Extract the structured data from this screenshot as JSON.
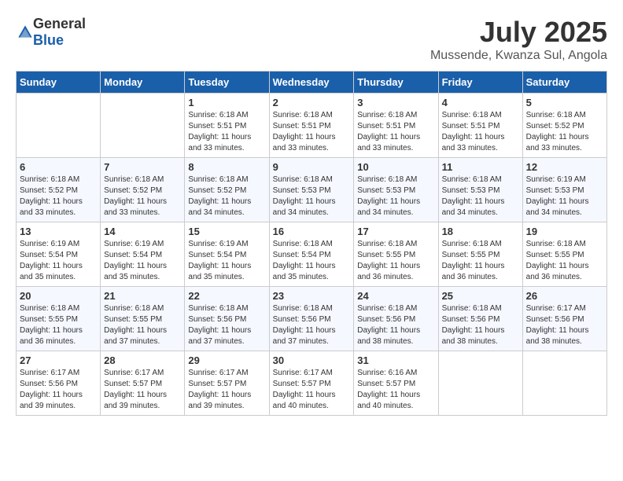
{
  "logo": {
    "text_general": "General",
    "text_blue": "Blue"
  },
  "header": {
    "month": "July 2025",
    "location": "Mussende, Kwanza Sul, Angola"
  },
  "weekdays": [
    "Sunday",
    "Monday",
    "Tuesday",
    "Wednesday",
    "Thursday",
    "Friday",
    "Saturday"
  ],
  "weeks": [
    [
      {
        "day": "",
        "sunrise": "",
        "sunset": "",
        "daylight": ""
      },
      {
        "day": "",
        "sunrise": "",
        "sunset": "",
        "daylight": ""
      },
      {
        "day": "1",
        "sunrise": "Sunrise: 6:18 AM",
        "sunset": "Sunset: 5:51 PM",
        "daylight": "Daylight: 11 hours and 33 minutes."
      },
      {
        "day": "2",
        "sunrise": "Sunrise: 6:18 AM",
        "sunset": "Sunset: 5:51 PM",
        "daylight": "Daylight: 11 hours and 33 minutes."
      },
      {
        "day": "3",
        "sunrise": "Sunrise: 6:18 AM",
        "sunset": "Sunset: 5:51 PM",
        "daylight": "Daylight: 11 hours and 33 minutes."
      },
      {
        "day": "4",
        "sunrise": "Sunrise: 6:18 AM",
        "sunset": "Sunset: 5:51 PM",
        "daylight": "Daylight: 11 hours and 33 minutes."
      },
      {
        "day": "5",
        "sunrise": "Sunrise: 6:18 AM",
        "sunset": "Sunset: 5:52 PM",
        "daylight": "Daylight: 11 hours and 33 minutes."
      }
    ],
    [
      {
        "day": "6",
        "sunrise": "Sunrise: 6:18 AM",
        "sunset": "Sunset: 5:52 PM",
        "daylight": "Daylight: 11 hours and 33 minutes."
      },
      {
        "day": "7",
        "sunrise": "Sunrise: 6:18 AM",
        "sunset": "Sunset: 5:52 PM",
        "daylight": "Daylight: 11 hours and 33 minutes."
      },
      {
        "day": "8",
        "sunrise": "Sunrise: 6:18 AM",
        "sunset": "Sunset: 5:52 PM",
        "daylight": "Daylight: 11 hours and 34 minutes."
      },
      {
        "day": "9",
        "sunrise": "Sunrise: 6:18 AM",
        "sunset": "Sunset: 5:53 PM",
        "daylight": "Daylight: 11 hours and 34 minutes."
      },
      {
        "day": "10",
        "sunrise": "Sunrise: 6:18 AM",
        "sunset": "Sunset: 5:53 PM",
        "daylight": "Daylight: 11 hours and 34 minutes."
      },
      {
        "day": "11",
        "sunrise": "Sunrise: 6:18 AM",
        "sunset": "Sunset: 5:53 PM",
        "daylight": "Daylight: 11 hours and 34 minutes."
      },
      {
        "day": "12",
        "sunrise": "Sunrise: 6:19 AM",
        "sunset": "Sunset: 5:53 PM",
        "daylight": "Daylight: 11 hours and 34 minutes."
      }
    ],
    [
      {
        "day": "13",
        "sunrise": "Sunrise: 6:19 AM",
        "sunset": "Sunset: 5:54 PM",
        "daylight": "Daylight: 11 hours and 35 minutes."
      },
      {
        "day": "14",
        "sunrise": "Sunrise: 6:19 AM",
        "sunset": "Sunset: 5:54 PM",
        "daylight": "Daylight: 11 hours and 35 minutes."
      },
      {
        "day": "15",
        "sunrise": "Sunrise: 6:19 AM",
        "sunset": "Sunset: 5:54 PM",
        "daylight": "Daylight: 11 hours and 35 minutes."
      },
      {
        "day": "16",
        "sunrise": "Sunrise: 6:18 AM",
        "sunset": "Sunset: 5:54 PM",
        "daylight": "Daylight: 11 hours and 35 minutes."
      },
      {
        "day": "17",
        "sunrise": "Sunrise: 6:18 AM",
        "sunset": "Sunset: 5:55 PM",
        "daylight": "Daylight: 11 hours and 36 minutes."
      },
      {
        "day": "18",
        "sunrise": "Sunrise: 6:18 AM",
        "sunset": "Sunset: 5:55 PM",
        "daylight": "Daylight: 11 hours and 36 minutes."
      },
      {
        "day": "19",
        "sunrise": "Sunrise: 6:18 AM",
        "sunset": "Sunset: 5:55 PM",
        "daylight": "Daylight: 11 hours and 36 minutes."
      }
    ],
    [
      {
        "day": "20",
        "sunrise": "Sunrise: 6:18 AM",
        "sunset": "Sunset: 5:55 PM",
        "daylight": "Daylight: 11 hours and 36 minutes."
      },
      {
        "day": "21",
        "sunrise": "Sunrise: 6:18 AM",
        "sunset": "Sunset: 5:55 PM",
        "daylight": "Daylight: 11 hours and 37 minutes."
      },
      {
        "day": "22",
        "sunrise": "Sunrise: 6:18 AM",
        "sunset": "Sunset: 5:56 PM",
        "daylight": "Daylight: 11 hours and 37 minutes."
      },
      {
        "day": "23",
        "sunrise": "Sunrise: 6:18 AM",
        "sunset": "Sunset: 5:56 PM",
        "daylight": "Daylight: 11 hours and 37 minutes."
      },
      {
        "day": "24",
        "sunrise": "Sunrise: 6:18 AM",
        "sunset": "Sunset: 5:56 PM",
        "daylight": "Daylight: 11 hours and 38 minutes."
      },
      {
        "day": "25",
        "sunrise": "Sunrise: 6:18 AM",
        "sunset": "Sunset: 5:56 PM",
        "daylight": "Daylight: 11 hours and 38 minutes."
      },
      {
        "day": "26",
        "sunrise": "Sunrise: 6:17 AM",
        "sunset": "Sunset: 5:56 PM",
        "daylight": "Daylight: 11 hours and 38 minutes."
      }
    ],
    [
      {
        "day": "27",
        "sunrise": "Sunrise: 6:17 AM",
        "sunset": "Sunset: 5:56 PM",
        "daylight": "Daylight: 11 hours and 39 minutes."
      },
      {
        "day": "28",
        "sunrise": "Sunrise: 6:17 AM",
        "sunset": "Sunset: 5:57 PM",
        "daylight": "Daylight: 11 hours and 39 minutes."
      },
      {
        "day": "29",
        "sunrise": "Sunrise: 6:17 AM",
        "sunset": "Sunset: 5:57 PM",
        "daylight": "Daylight: 11 hours and 39 minutes."
      },
      {
        "day": "30",
        "sunrise": "Sunrise: 6:17 AM",
        "sunset": "Sunset: 5:57 PM",
        "daylight": "Daylight: 11 hours and 40 minutes."
      },
      {
        "day": "31",
        "sunrise": "Sunrise: 6:16 AM",
        "sunset": "Sunset: 5:57 PM",
        "daylight": "Daylight: 11 hours and 40 minutes."
      },
      {
        "day": "",
        "sunrise": "",
        "sunset": "",
        "daylight": ""
      },
      {
        "day": "",
        "sunrise": "",
        "sunset": "",
        "daylight": ""
      }
    ]
  ]
}
